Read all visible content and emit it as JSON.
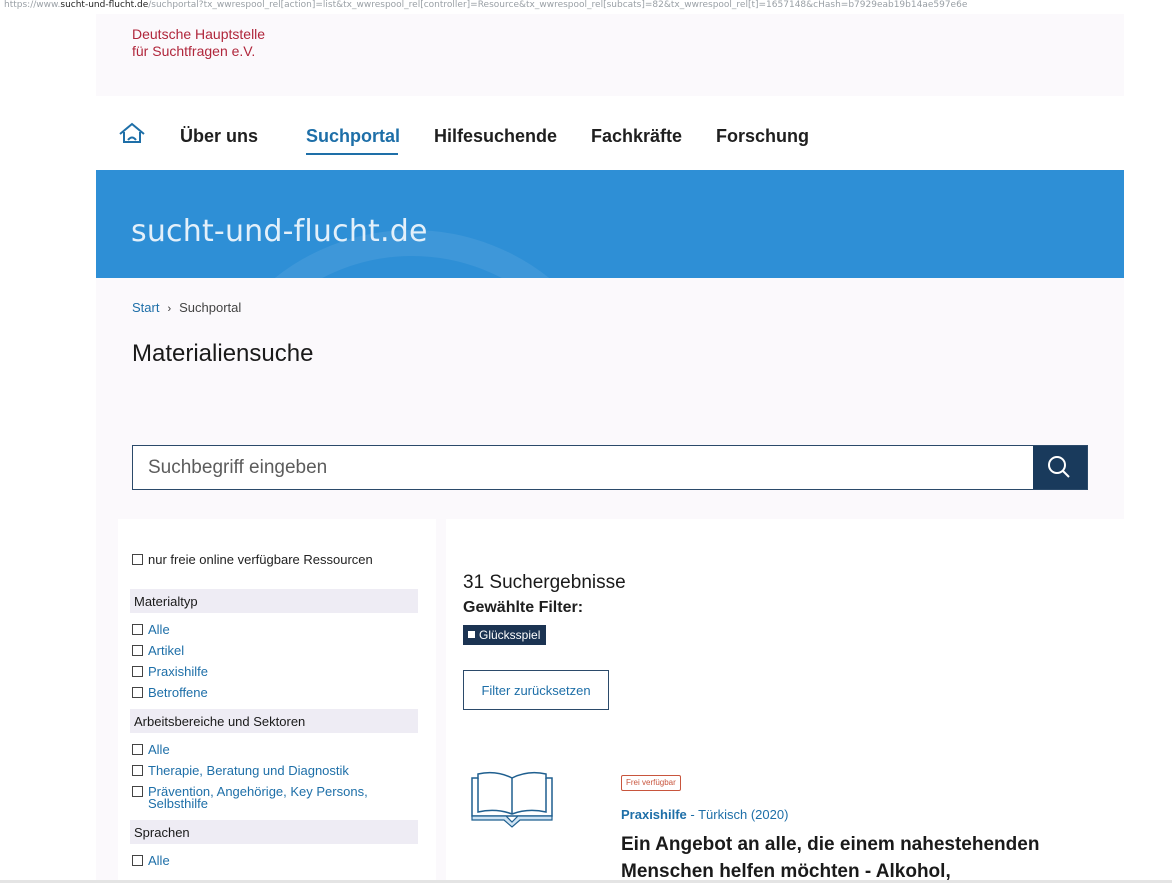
{
  "browser": {
    "url_prefix": "https://www.",
    "url_host": "sucht-und-flucht.de",
    "url_rest": "/suchportal?tx_wwrespool_rel[action]=list&tx_wwrespool_rel[controller]=Resource&tx_wwrespool_rel[subcats]=82&tx_wwrespool_rel[t]=1657148&cHash=b7929eab19b14ae597e6e"
  },
  "header": {
    "org_line1": "Deutsche Hauptstelle",
    "org_line2": "für Suchtfragen e.V."
  },
  "nav": {
    "items": [
      {
        "label": "Über uns"
      },
      {
        "label": "Suchportal"
      },
      {
        "label": "Hilfesuchende"
      },
      {
        "label": "Fachkräfte"
      },
      {
        "label": "Forschung"
      }
    ],
    "active": "Suchportal"
  },
  "hero": {
    "title": "sucht-und-flucht.de"
  },
  "breadcrumb": {
    "start": "Start",
    "separator": "›",
    "current": "Suchportal"
  },
  "page_title": "Materialiensuche",
  "search": {
    "placeholder": "Suchbegriff eingeben"
  },
  "filters": {
    "free_online": "nur freie online verfügbare Ressourcen",
    "groups": [
      {
        "heading": "Materialtyp",
        "options": [
          "Alle",
          "Artikel",
          "Praxishilfe",
          "Betroffene"
        ]
      },
      {
        "heading": "Arbeitsbereiche und Sektoren",
        "options": [
          "Alle",
          "Therapie, Beratung und Diagnostik",
          "Prävention, Angehörige, Key Persons,",
          "Selbsthilfe"
        ]
      },
      {
        "heading": "Sprachen",
        "options": [
          "Alle"
        ]
      }
    ]
  },
  "results": {
    "count_label": "31 Suchergebnisse",
    "selected_filters_label": "Gewählte Filter:",
    "selected_filter": "Glücksspiel",
    "reset_label": "Filter zurücksetzen",
    "items": [
      {
        "badge": "Frei verfügbar",
        "type": "Praxishilfe",
        "meta": " - Türkisch (2020)",
        "title_line1": "Ein Angebot an alle, die einem nahestehenden",
        "title_line2": "Menschen helfen möchten - Alkohol, Medikamente"
      }
    ]
  },
  "colors": {
    "brand_red": "#b0263b",
    "link_blue": "#1e6fa8",
    "hero_blue": "#2e8fd6",
    "navy": "#193a5c"
  }
}
